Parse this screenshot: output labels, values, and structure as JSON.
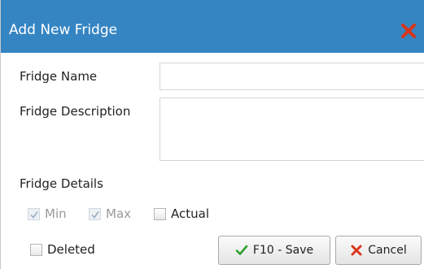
{
  "dialog": {
    "title": "Add New Fridge",
    "close_icon": "close-icon",
    "accent_color": "#3585c3",
    "close_color": "#d9351b"
  },
  "form": {
    "name_label": "Fridge Name",
    "name_value": "",
    "description_label": "Fridge Description",
    "description_value": "",
    "details_label": "Fridge Details",
    "checkboxes": {
      "min": {
        "label": "Min",
        "checked": true,
        "disabled": true
      },
      "max": {
        "label": "Max",
        "checked": true,
        "disabled": true
      },
      "actual": {
        "label": "Actual",
        "checked": false,
        "disabled": false
      },
      "deleted": {
        "label": "Deleted",
        "checked": false,
        "disabled": false
      }
    }
  },
  "buttons": {
    "save_label": "F10 - Save",
    "save_icon": "checkmark-icon",
    "cancel_label": "Cancel",
    "cancel_icon": "x-icon"
  }
}
